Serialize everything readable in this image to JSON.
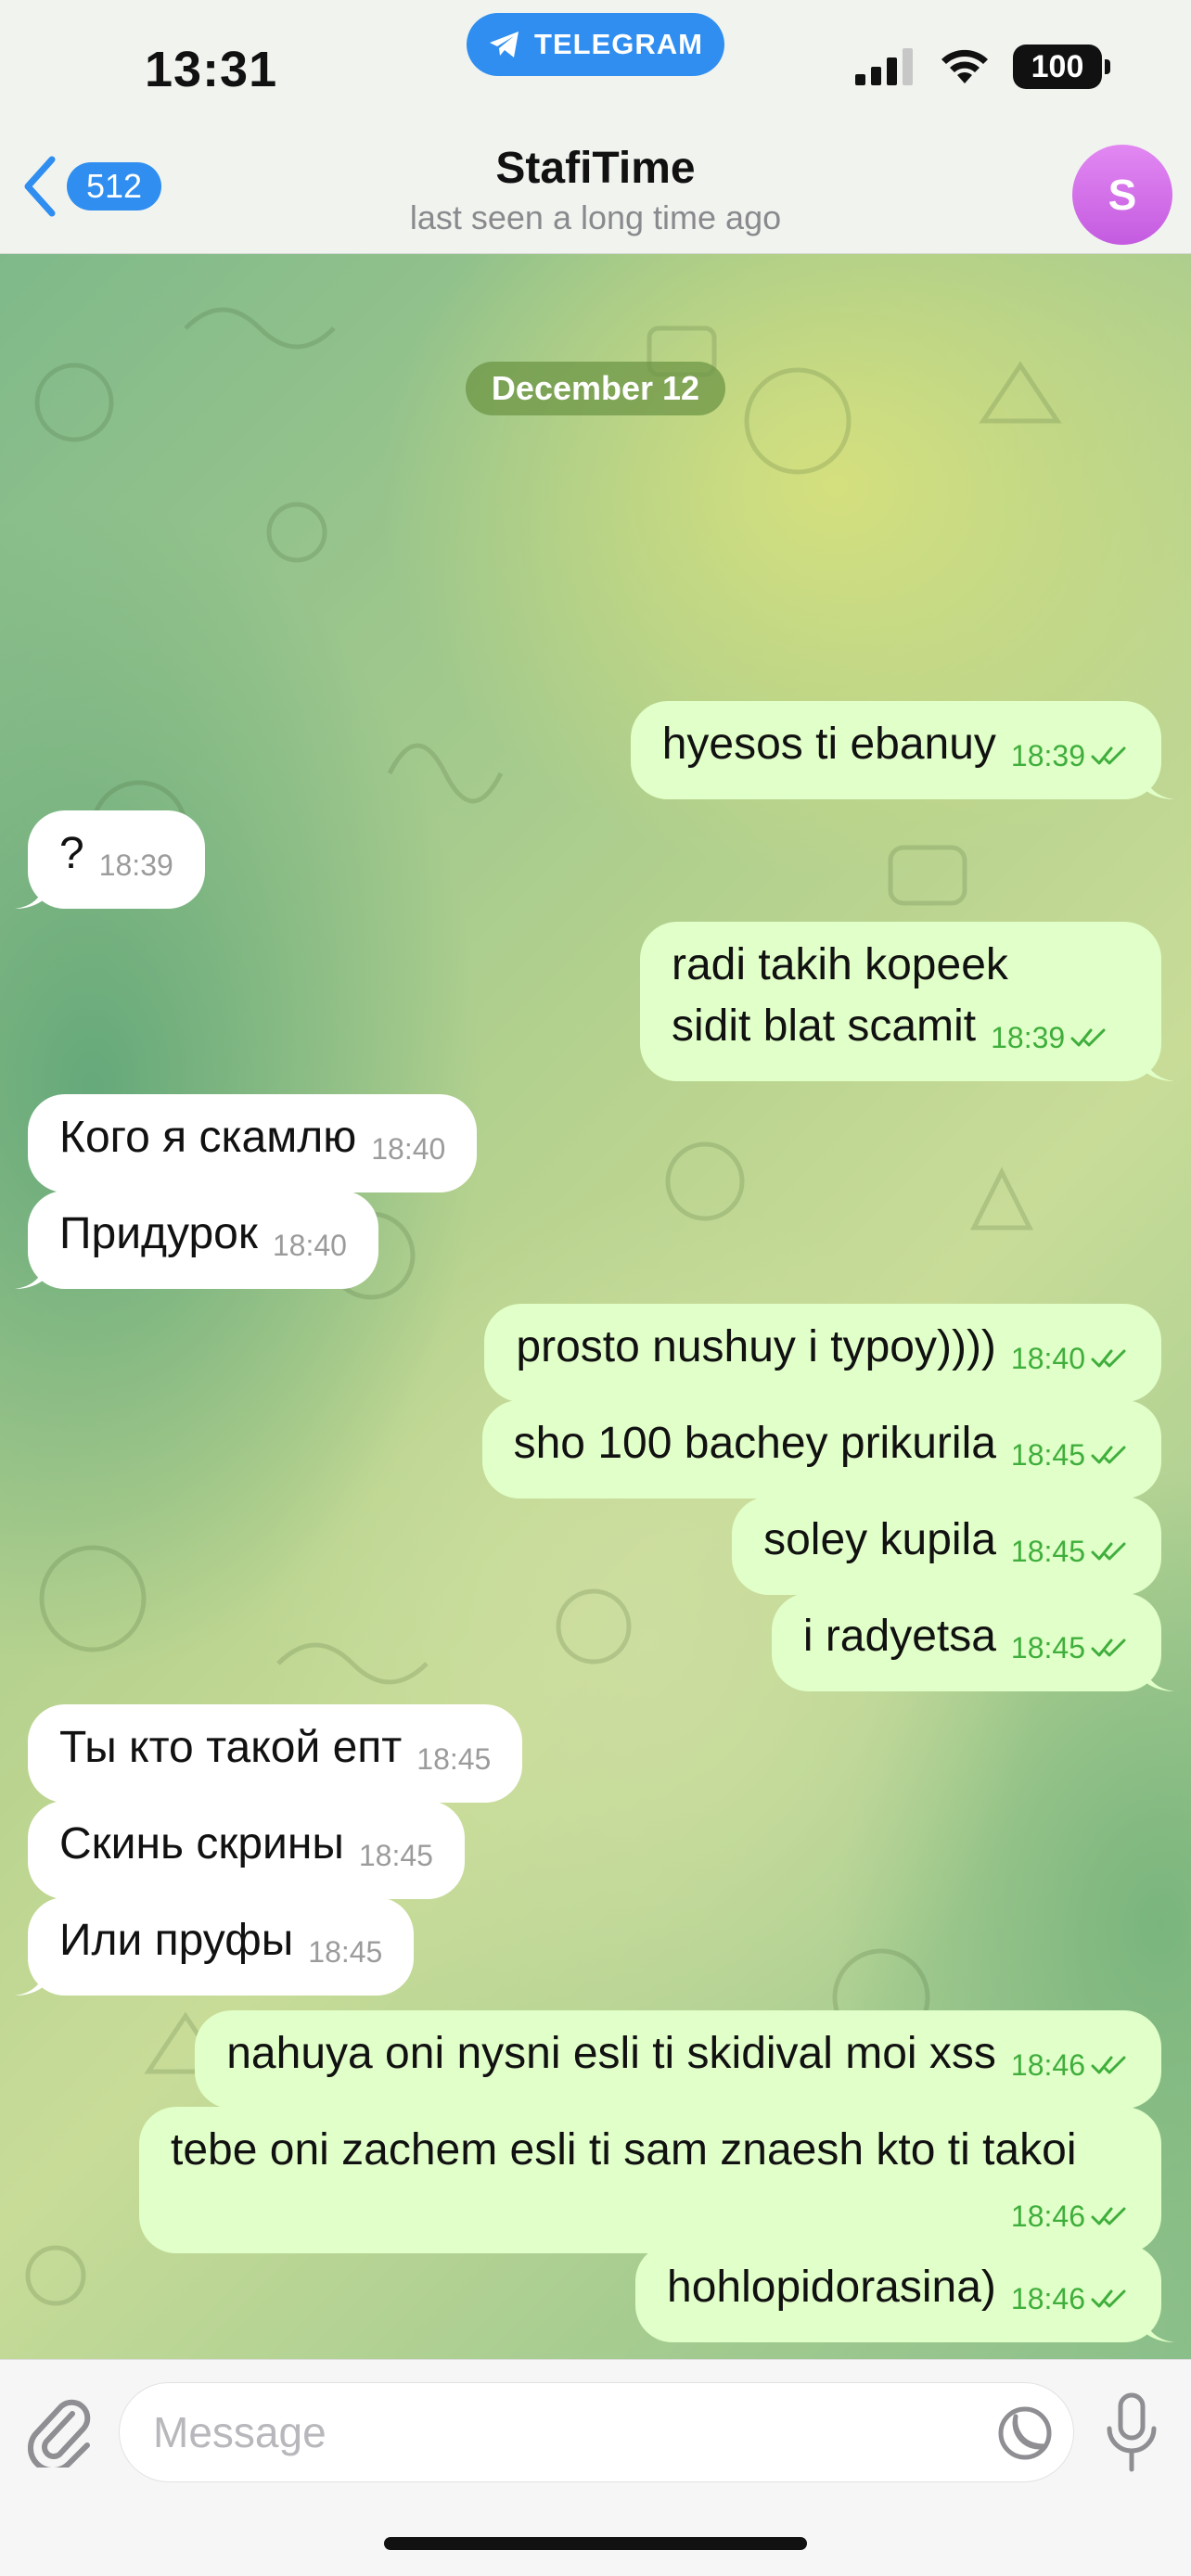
{
  "status_bar": {
    "time": "13:31",
    "app_pill": "TELEGRAM",
    "battery": "100"
  },
  "header": {
    "back_count": "512",
    "title": "StafiTime",
    "subtitle": "last seen a long time ago",
    "avatar_letter": "S"
  },
  "chat": {
    "date": "December 12",
    "messages": [
      {
        "dir": "out",
        "text": "hyesos ti ebanuy",
        "time": "18:39"
      },
      {
        "dir": "in",
        "text": "?",
        "time": "18:39"
      },
      {
        "dir": "out",
        "text_line1": "radi takih kopeek",
        "text_line2": "sidit blat scamit",
        "time": "18:39"
      },
      {
        "dir": "in",
        "text": "Кого я скамлю",
        "time": "18:40"
      },
      {
        "dir": "in",
        "text": "Придурок",
        "time": "18:40"
      },
      {
        "dir": "out",
        "text": "prosto nushuy i typoy))))",
        "time": "18:40"
      },
      {
        "dir": "out",
        "text": "sho 100 bachey prikurila",
        "time": "18:45"
      },
      {
        "dir": "out",
        "text": "soley kupila",
        "time": "18:45"
      },
      {
        "dir": "out",
        "text": "i radyetsa",
        "time": "18:45"
      },
      {
        "dir": "in",
        "text": "Ты кто такой епт",
        "time": "18:45"
      },
      {
        "dir": "in",
        "text": "Скинь скрины",
        "time": "18:45"
      },
      {
        "dir": "in",
        "text": "Или пруфы",
        "time": "18:45"
      },
      {
        "dir": "out",
        "text": "nahuya oni nysni esli ti skidival moi xss",
        "time": "18:46"
      },
      {
        "dir": "out",
        "text": "tebe oni zachem esli ti sam znaesh kto ti takoi",
        "time": "18:46"
      },
      {
        "dir": "out",
        "text": "hohlopidorasina)",
        "time": "18:46"
      }
    ]
  },
  "composer": {
    "placeholder": "Message"
  },
  "colors": {
    "accent": "#2f8ef0",
    "outgoing_bubble": "#e1ffc8",
    "incoming_bubble": "#ffffff",
    "read_check": "#3fae3c",
    "date_pill": "#6e9646"
  },
  "icons": [
    "telegram-icon",
    "signal-icon",
    "wifi-icon",
    "back-chevron-icon",
    "paperclip-icon",
    "sticker-icon",
    "microphone-icon",
    "double-check-icon"
  ]
}
